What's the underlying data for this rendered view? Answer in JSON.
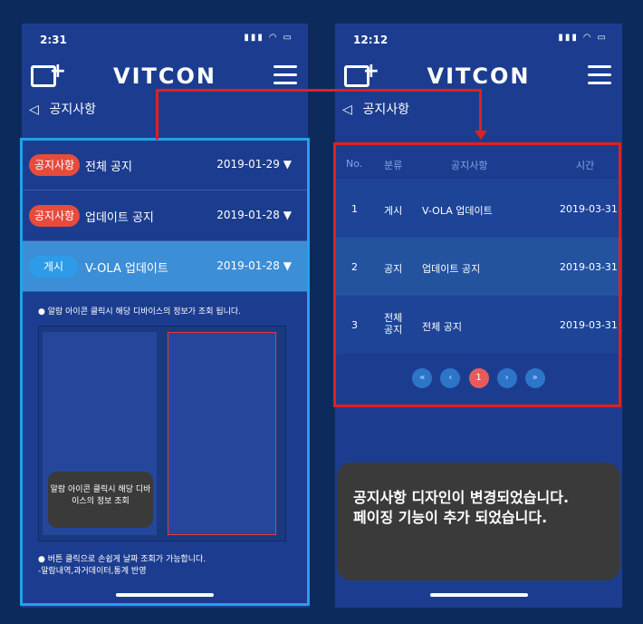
{
  "left": {
    "time": "2:31",
    "logo": "VITCON",
    "notice_title": "공지사항",
    "rows": [
      {
        "tag": "공지사항",
        "title": "전체 공지",
        "date": "2019-01-29"
      },
      {
        "tag": "공지사항",
        "title": "업데이트 공지",
        "date": "2019-01-28"
      },
      {
        "tag": "게시",
        "title": "V-OLA 업데이트",
        "date": "2019-01-28"
      }
    ],
    "expanded_text": "● 알람 아이콘 클릭시 해당 디바이스의 정보가 조회 됩니다.",
    "tooltip": "알람 아이콘 클릭시 해당 디바이스의 정보 조회",
    "bullet1": "● 버튼 클릭으로 손쉽게 날짜 조회가 가능합니다.",
    "bullet2": "-알람내역,과거데이터,통계 반영"
  },
  "right": {
    "time": "12:12",
    "logo": "VITCON",
    "notice_title": "공지사항",
    "headers": {
      "no": "No.",
      "cat": "분류",
      "title": "공지사항",
      "time": "시간"
    },
    "rows": [
      {
        "no": "1",
        "cat": "게시",
        "title": "V-OLA 업데이트",
        "date": "2019-03-31"
      },
      {
        "no": "2",
        "cat": "공지",
        "title": "업데이트 공지",
        "date": "2019-03-31"
      },
      {
        "no": "3",
        "cat": "전체\n공지",
        "title": "전체 공지",
        "date": "2019-03-31"
      }
    ],
    "page": "1"
  },
  "callout": "공지사항 디자인이 변경되었습니다.\n페이징 기능이 추가 되었습니다."
}
